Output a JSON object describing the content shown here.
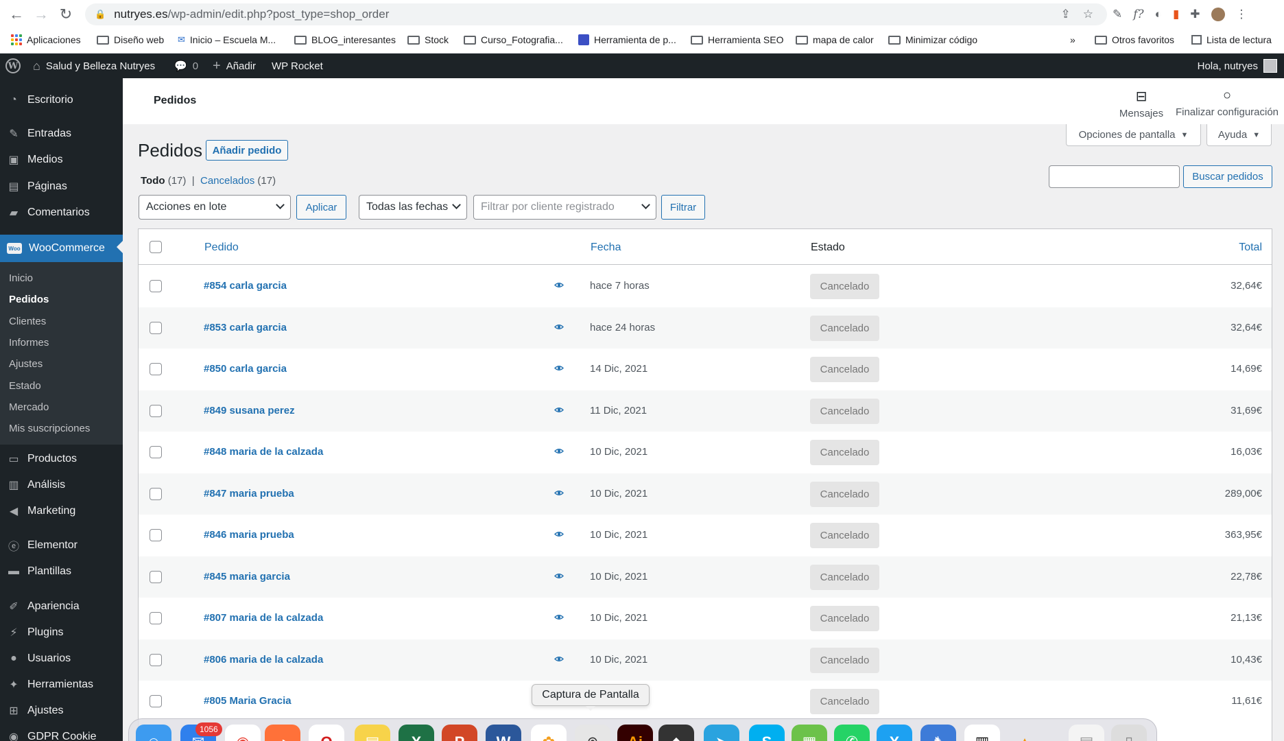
{
  "browser": {
    "url_host": "nutryes.es",
    "url_path": "/wp-admin/edit.php?post_type=shop_order",
    "bookmarks": [
      {
        "label": "Aplicaciones",
        "icon": "apps-grid-icon"
      },
      {
        "label": "Diseño web",
        "icon": "folder-icon"
      },
      {
        "label": "Inicio – Escuela M...",
        "icon": "site-favicon-icon"
      },
      {
        "label": "BLOG_interesantes",
        "icon": "folder-icon"
      },
      {
        "label": "Stock",
        "icon": "folder-icon"
      },
      {
        "label": "Curso_Fotografia...",
        "icon": "folder-icon"
      },
      {
        "label": "Herramienta de p...",
        "icon": "site-favicon-icon"
      },
      {
        "label": "Herramienta SEO",
        "icon": "folder-icon"
      },
      {
        "label": "mapa de calor",
        "icon": "folder-icon"
      },
      {
        "label": "Minimizar código",
        "icon": "folder-icon"
      }
    ],
    "more_label": "»",
    "other_favorites": "Otros favoritos",
    "reading_list": "Lista de lectura"
  },
  "adminbar": {
    "site_name": "Salud y Belleza Nutryes",
    "comments_count": "0",
    "add_new": "Añadir",
    "wp_rocket": "WP Rocket",
    "greeting": "Hola, nutryes"
  },
  "sidebar": {
    "items": [
      {
        "label": "Escritorio",
        "icon": "dashboard-icon"
      },
      {
        "label": "Entradas",
        "icon": "pin-icon"
      },
      {
        "label": "Medios",
        "icon": "media-icon"
      },
      {
        "label": "Páginas",
        "icon": "pages-icon"
      },
      {
        "label": "Comentarios",
        "icon": "comment-icon"
      },
      {
        "label": "WooCommerce",
        "icon": "woocommerce-icon"
      }
    ],
    "submenu": [
      "Inicio",
      "Pedidos",
      "Clientes",
      "Informes",
      "Ajustes",
      "Estado",
      "Mercado",
      "Mis suscripciones"
    ],
    "items_bottom": [
      {
        "label": "Productos",
        "icon": "products-icon"
      },
      {
        "label": "Análisis",
        "icon": "analytics-icon"
      },
      {
        "label": "Marketing",
        "icon": "megaphone-icon"
      },
      {
        "label": "Elementor",
        "icon": "elementor-icon"
      },
      {
        "label": "Plantillas",
        "icon": "folder-icon"
      },
      {
        "label": "Apariencia",
        "icon": "brush-icon"
      },
      {
        "label": "Plugins",
        "icon": "plug-icon"
      },
      {
        "label": "Usuarios",
        "icon": "user-icon"
      },
      {
        "label": "Herramientas",
        "icon": "wrench-icon"
      },
      {
        "label": "Ajustes",
        "icon": "settings-icon"
      },
      {
        "label": "GDPR Cookie",
        "icon": "cookie-icon"
      }
    ]
  },
  "wc_header": {
    "title": "Pedidos",
    "messages": "Mensajes",
    "finish_setup": "Finalizar configuración"
  },
  "screen_options": "Opciones de pantalla",
  "help": "Ayuda",
  "page": {
    "title": "Pedidos",
    "add_order": "Añadir pedido",
    "filter_all": "Todo",
    "filter_all_count": "(17)",
    "separator": "|",
    "filter_cancelled": "Cancelados",
    "filter_cancelled_count": "(17)",
    "search_button": "Buscar pedidos",
    "bulk_actions": "Acciones en lote",
    "apply": "Aplicar",
    "all_dates": "Todas las fechas",
    "customer_filter_placeholder": "Filtrar por cliente registrado",
    "filter": "Filtrar"
  },
  "table": {
    "columns": {
      "order": "Pedido",
      "date": "Fecha",
      "status": "Estado",
      "total": "Total"
    },
    "rows": [
      {
        "order": "#854 carla garcia",
        "date": "hace 7 horas",
        "status": "Cancelado",
        "total": "32,64€"
      },
      {
        "order": "#853 carla garcia",
        "date": "hace 24 horas",
        "status": "Cancelado",
        "total": "32,64€"
      },
      {
        "order": "#850 carla garcia",
        "date": "14 Dic, 2021",
        "status": "Cancelado",
        "total": "14,69€"
      },
      {
        "order": "#849 susana perez",
        "date": "11 Dic, 2021",
        "status": "Cancelado",
        "total": "31,69€"
      },
      {
        "order": "#848 maria de la calzada",
        "date": "10 Dic, 2021",
        "status": "Cancelado",
        "total": "16,03€"
      },
      {
        "order": "#847 maria prueba",
        "date": "10 Dic, 2021",
        "status": "Cancelado",
        "total": "289,00€"
      },
      {
        "order": "#846 maria prueba",
        "date": "10 Dic, 2021",
        "status": "Cancelado",
        "total": "363,95€"
      },
      {
        "order": "#845 maria garcia",
        "date": "10 Dic, 2021",
        "status": "Cancelado",
        "total": "22,78€"
      },
      {
        "order": "#807 maria de la calzada",
        "date": "10 Dic, 2021",
        "status": "Cancelado",
        "total": "21,13€"
      },
      {
        "order": "#806 maria de la calzada",
        "date": "10 Dic, 2021",
        "status": "Cancelado",
        "total": "10,43€"
      },
      {
        "order": "#805 Maria Gracia",
        "date": "",
        "status": "Cancelado",
        "total": "11,61€"
      }
    ]
  },
  "dock": {
    "tooltip": "Captura de Pantalla",
    "mail_badge": "1056"
  },
  "colors": {
    "accent": "#2271b1",
    "admin_dark": "#1d2327"
  }
}
